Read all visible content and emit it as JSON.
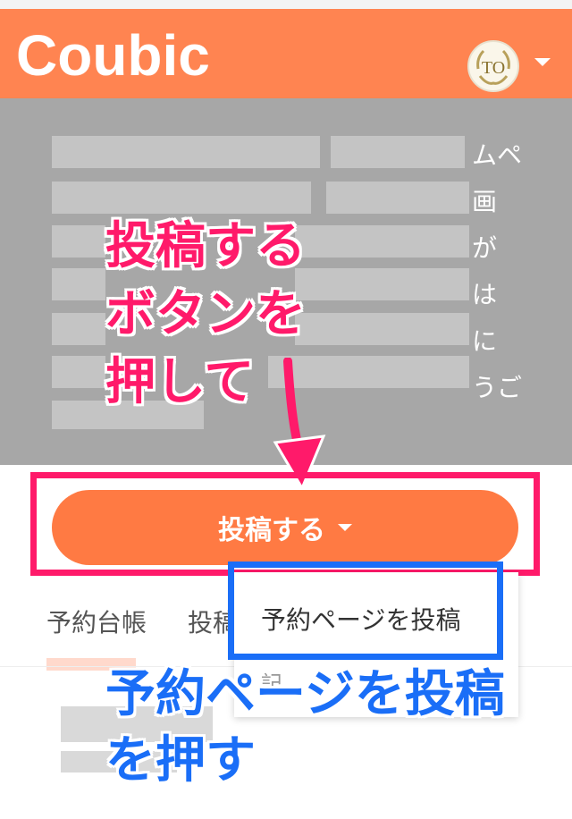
{
  "header": {
    "app_name": "Coubic",
    "avatar_initials": "TO",
    "brand_color": "#ff8451"
  },
  "hero": {
    "visible_text_right": "ムペ\n画\nが\nは\nに\nうご"
  },
  "annotations": {
    "top_callout": "投稿する\nボタンを\n押して",
    "bottom_callout": "予約ページを投稿\nを押す",
    "pink_color": "#ff1a6a",
    "blue_color": "#1a6ef7"
  },
  "post_button": {
    "label": "投稿する"
  },
  "tabs": [
    {
      "label": "予約台帳"
    },
    {
      "label": "投稿"
    }
  ],
  "dropdown": {
    "items": [
      {
        "label": "予約ページを投稿"
      },
      {
        "label": "記"
      }
    ]
  }
}
